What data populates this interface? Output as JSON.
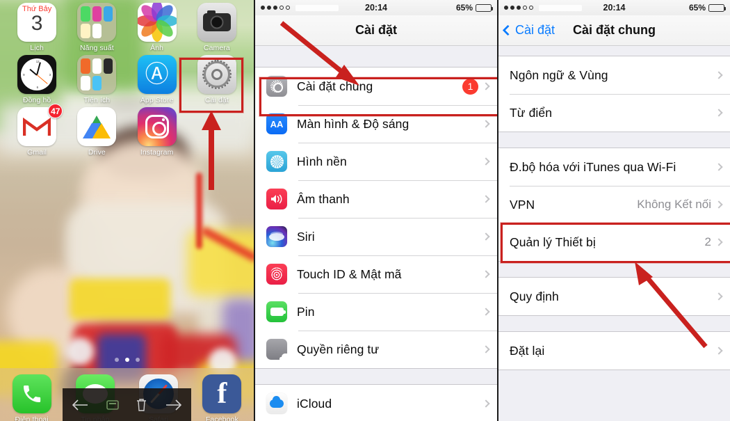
{
  "home": {
    "apps": [
      {
        "name": "Lịch",
        "icon": "calendar-icon",
        "dow": "Thứ Bảy",
        "day": "3",
        "badge": null
      },
      {
        "name": "Năng suất",
        "icon": "folder-icon",
        "badge": null
      },
      {
        "name": "Ảnh",
        "icon": "photos-icon",
        "badge": null
      },
      {
        "name": "Camera",
        "icon": "camera-icon",
        "badge": null
      },
      {
        "name": "Đồng hồ",
        "icon": "clock-icon",
        "badge": null
      },
      {
        "name": "Tiện ích",
        "icon": "folder-icon",
        "badge": null
      },
      {
        "name": "App Store",
        "icon": "appstore-icon",
        "badge": null
      },
      {
        "name": "Cài đặt",
        "icon": "settings-gear-icon",
        "badge": null
      },
      {
        "name": "Gmail",
        "icon": "gmail-icon",
        "badge": "47"
      },
      {
        "name": "Drive",
        "icon": "drive-icon",
        "badge": null
      },
      {
        "name": "Instagram",
        "icon": "instagram-icon",
        "badge": null
      }
    ],
    "page_dots": {
      "count": 3,
      "active_index": 1
    },
    "dock": [
      {
        "name": "Điện thoại",
        "icon": "phone-icon"
      },
      {
        "name": "Tin nhắn",
        "icon": "message-icon"
      },
      {
        "name": "Safari",
        "icon": "safari-icon"
      },
      {
        "name": "Facebook",
        "icon": "facebook-icon"
      }
    ],
    "nav_overlay": [
      {
        "icon": "back-arrow-icon"
      },
      {
        "icon": "keyboard-icon"
      },
      {
        "icon": "trash-icon"
      },
      {
        "icon": "forward-arrow-icon"
      }
    ]
  },
  "settings_panel": {
    "statusbar": {
      "time": "20:14",
      "battery_percent": "65%",
      "signal_dots_filled": 3,
      "signal_dots_total": 5
    },
    "title": "Cài đặt",
    "groups": [
      {
        "rows": [
          {
            "label": "Cài đặt chung",
            "icon": "gear-icon",
            "badge": "1",
            "chevron": true,
            "highlighted": true
          },
          {
            "label": "Màn hình & Độ sáng",
            "icon": "aa-icon",
            "chevron": true
          },
          {
            "label": "Hình nền",
            "icon": "wallpaper-icon",
            "chevron": true
          },
          {
            "label": "Âm thanh",
            "icon": "speaker-icon",
            "chevron": true
          },
          {
            "label": "Siri",
            "icon": "siri-icon",
            "chevron": true
          },
          {
            "label": "Touch ID & Mật mã",
            "icon": "fingerprint-icon",
            "chevron": true
          },
          {
            "label": "Pin",
            "icon": "battery-icon",
            "chevron": true
          },
          {
            "label": "Quyền riêng tư",
            "icon": "hand-icon",
            "chevron": true
          }
        ]
      },
      {
        "rows": [
          {
            "label": "iCloud",
            "icon": "icloud-icon",
            "chevron": true
          }
        ]
      }
    ]
  },
  "general_panel": {
    "statusbar": {
      "time": "20:14",
      "battery_percent": "65%",
      "signal_dots_filled": 3,
      "signal_dots_total": 5
    },
    "back_label": "Cài đặt",
    "title": "Cài đặt chung",
    "groups": [
      {
        "rows": [
          {
            "label": "Ngôn ngữ & Vùng",
            "chevron": true
          },
          {
            "label": "Từ điển",
            "chevron": true
          }
        ]
      },
      {
        "rows": [
          {
            "label": "Đ.bộ hóa với iTunes qua Wi-Fi",
            "chevron": true
          },
          {
            "label": "VPN",
            "value": "Không Kết nối",
            "chevron": true
          },
          {
            "label": "Quản lý Thiết bị",
            "value": "2",
            "chevron": true,
            "highlighted": true
          }
        ]
      },
      {
        "rows": [
          {
            "label": "Quy định",
            "chevron": true
          }
        ]
      },
      {
        "rows": [
          {
            "label": "Đặt lại",
            "chevron": true
          }
        ]
      }
    ]
  },
  "annotations": {
    "accent_color": "#c9211e",
    "callouts": [
      {
        "name": "settings-app-highlight",
        "target": "Cài đặt"
      },
      {
        "name": "general-settings-row-highlight",
        "target": "Cài đặt chung"
      },
      {
        "name": "device-management-row-highlight",
        "target": "Quản lý Thiết bị"
      }
    ]
  }
}
